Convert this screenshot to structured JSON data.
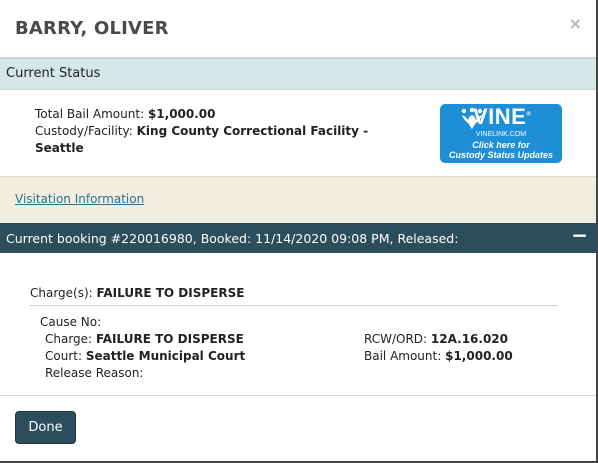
{
  "modal": {
    "title": "BARRY, OLIVER",
    "close_label": "×"
  },
  "current_status": {
    "heading": "Current Status",
    "total_bail_label": "Total Bail Amount:",
    "total_bail_value": "$1,000.00",
    "custody_label": "Custody/Facility:",
    "custody_value_line1": "King County Correctional Facility -",
    "custody_value_line2": "Seattle"
  },
  "vine": {
    "brand": "VINE",
    "registered": "®",
    "site": "VINELINK.COM",
    "cta_line1": "Click here for",
    "cta_line2": "Custody Status Updates",
    "color": "#1e8fd6"
  },
  "visitation": {
    "link_label": "Visitation Information"
  },
  "booking": {
    "title": "Current booking #220016980, Booked: 11/14/2020 09:08 PM, Released:",
    "collapse_label": "−",
    "charges_label": "Charge(s):",
    "charges_value": "FAILURE TO DISPERSE",
    "cause_no_label": "Cause No:",
    "cause_no_value": "",
    "charge_label": "Charge:",
    "charge_value": "FAILURE TO DISPERSE",
    "court_label": "Court:",
    "court_value": "Seattle Municipal Court",
    "release_reason_label": "Release Reason:",
    "release_reason_value": "",
    "rcw_label": "RCW/ORD:",
    "rcw_value": "12A.16.020",
    "bail_label": "Bail Amount:",
    "bail_value": "$1,000.00"
  },
  "footer": {
    "done_label": "Done"
  },
  "colors": {
    "header_bar": "#2b4d5c",
    "status_bar": "#d7e6e8",
    "visitation_bg": "#f0eee1",
    "link": "#2f6f8f"
  }
}
